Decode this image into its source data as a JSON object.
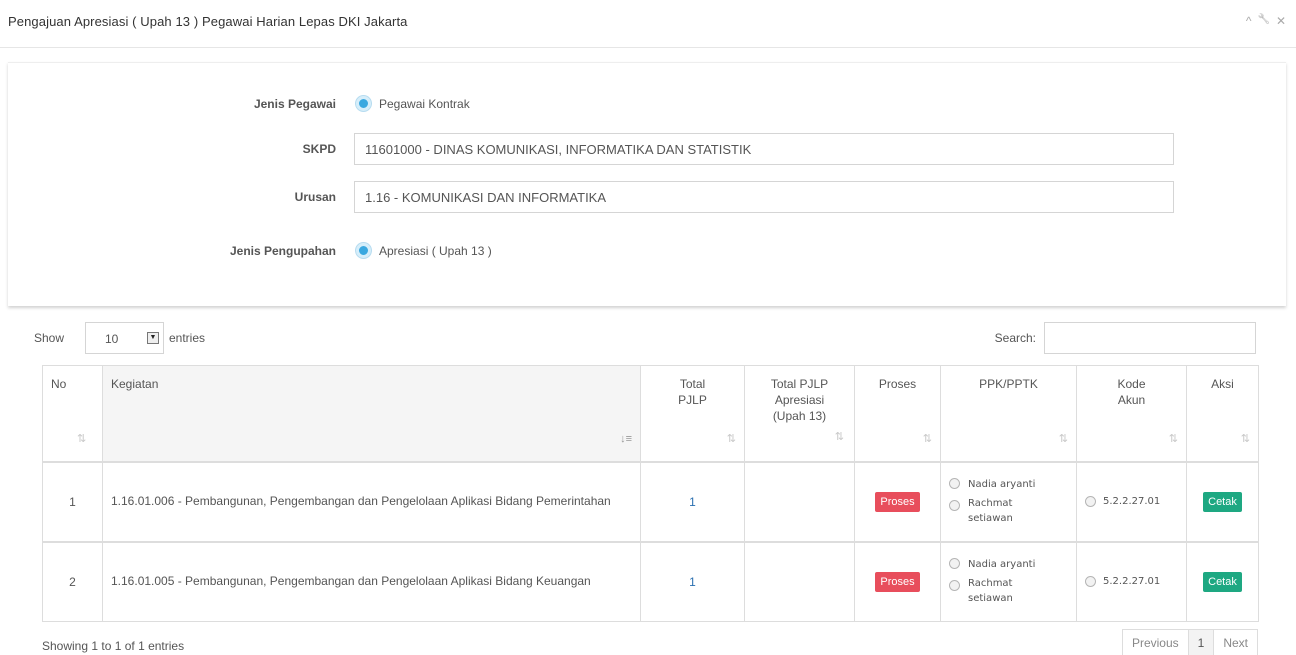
{
  "panel": {
    "title": "Pengajuan Apresiasi ( Upah 13 ) Pegawai Harian Lepas DKI Jakarta",
    "tools": {
      "collapse": "^",
      "settings": "🔧",
      "close": "✕"
    }
  },
  "form": {
    "jenis_pegawai": {
      "label": "Jenis Pegawai",
      "value": "Pegawai Kontrak"
    },
    "skpd": {
      "label": "SKPD",
      "value": "11601000 - DINAS KOMUNIKASI, INFORMATIKA DAN STATISTIK"
    },
    "urusan": {
      "label": "Urusan",
      "value": "1.16 - KOMUNIKASI DAN INFORMATIKA"
    },
    "jenis_pengupahan": {
      "label": "Jenis Pengupahan",
      "value": "Apresiasi ( Upah 13 )"
    }
  },
  "datatable": {
    "show_label": "Show",
    "length_value": "10",
    "entries_label": "entries",
    "search_label": "Search:",
    "columns": {
      "no": "No",
      "kegiatan": "Kegiatan",
      "total_pjlp": "Total PJLP",
      "total_pjlp_apresiasi": "Total PJLP Apresiasi (Upah 13)",
      "proses": "Proses",
      "ppk_pptk": "PPK/PPTK",
      "kode_akun": "Kode Akun",
      "aksi": "Aksi"
    },
    "rows": [
      {
        "no": "1",
        "kegiatan": "1.16.01.006 - Pembangunan, Pengembangan dan Pengelolaan Aplikasi Bidang Pemerintahan",
        "total_pjlp": "1",
        "total_apresiasi": "",
        "proses_label": "Proses",
        "ppk_1": "Nadia aryanti",
        "ppk_2": "Rachmat setiawan",
        "kode_akun": "5.2.2.27.01",
        "aksi_label": "Cetak"
      },
      {
        "no": "2",
        "kegiatan": "1.16.01.005 - Pembangunan, Pengembangan dan Pengelolaan Aplikasi Bidang Keuangan",
        "total_pjlp": "1",
        "total_apresiasi": "",
        "proses_label": "Proses",
        "ppk_1": "Nadia aryanti",
        "ppk_2": "Rachmat setiawan",
        "kode_akun": "5.2.2.27.01",
        "aksi_label": "Cetak"
      }
    ],
    "info": "Showing 1 to 1 of 1 entries",
    "pagination": {
      "previous": "Previous",
      "current": "1",
      "next": "Next"
    }
  },
  "colors": {
    "proses_button": "#e84e5c",
    "cetak_button": "#1ea882",
    "radio_active": "#3aa8e0",
    "link": "#2a6fb0"
  }
}
